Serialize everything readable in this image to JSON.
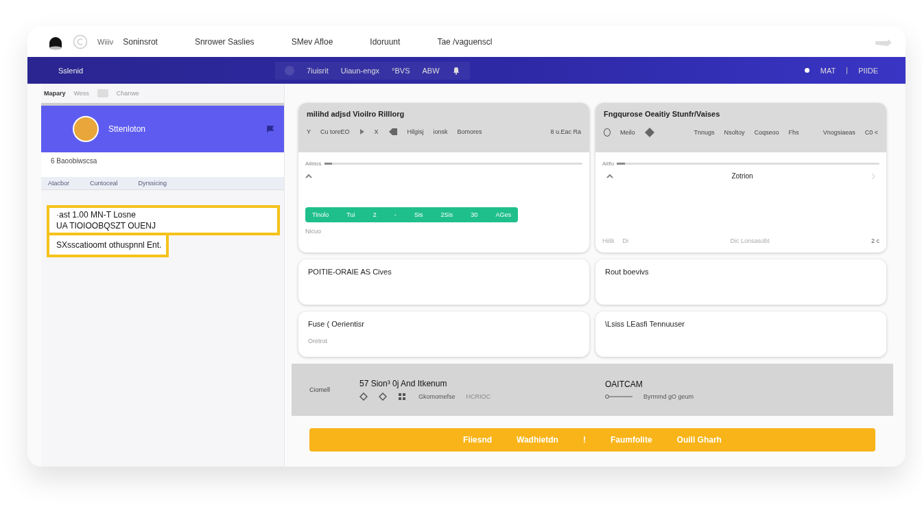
{
  "top_nav": {
    "items": [
      "Wiiiv",
      "Soninsrot",
      "Snrower Saslies",
      "SMev Afloe",
      "Idoruunt",
      "Tae /vaguenscl"
    ]
  },
  "header": {
    "title": "Sslenid",
    "center": [
      "7iuisrit",
      "Uiaun-engx",
      "°BVS",
      "ABW"
    ],
    "right": [
      "MAT",
      "PIIDE"
    ]
  },
  "sidebar": {
    "toolbar": [
      "Mapary",
      "Wess",
      "Chanwe"
    ],
    "profile_name": "Sttenloton",
    "subtitle": "6 Baoobiwscsa",
    "tabs": [
      {
        "label": "Atacbor",
        "selected": false
      },
      {
        "label": "Cuntoceal",
        "selected": false
      },
      {
        "label": "Dyrssicing",
        "selected": false
      }
    ],
    "notes": [
      {
        "lines": [
          "·ast 1.00 MN-T Losne",
          "UA TIOIOOBQSZT OUENJ"
        ]
      },
      {
        "lines": [
          "SXsscatioomt othuspnnl Ent."
        ]
      }
    ]
  },
  "panels": [
    {
      "title": "milihd adjsd Vioilro Rilllorg",
      "toolbar": [
        "Y",
        "Cu toreEO",
        "X",
        "Hilgisj",
        "ionsk",
        "Bomores",
        "8 u.Eac Ra"
      ],
      "slider": {
        "label": "Aiiblos",
        "level": 0.03
      },
      "pill": [
        "Tinolo",
        "Tui",
        "2",
        "-",
        "Sis",
        "2Sis",
        "30",
        "AGes"
      ],
      "caption": "Nicuo"
    },
    {
      "title": "Fngqurose Oeaitiy Stunfr/Vaises",
      "toolbar": [
        "Meilo",
        "Tnnugs",
        "Nsoltoy",
        "Coqseoo",
        "Fhs",
        "Vnogsiaeas",
        "C0 <"
      ],
      "slider": {
        "label": "Aiiflo",
        "level": 0.03
      },
      "center": "Zotrion",
      "footer": [
        "Hiitk",
        "Di",
        "Dic Lonsasobt",
        "2 c"
      ]
    }
  ],
  "cards": [
    {
      "title": "POITIE-ORAIE AS Cives"
    },
    {
      "title": "Rout boevivs"
    },
    {
      "title": "Fuse ( Oerientisr",
      "subtitle": "Oretrot"
    },
    {
      "title": "\\Lsiss LEasfi Tennuuser"
    }
  ],
  "summary": {
    "label": "Ciomell",
    "title": "57 Sion³ 0j And Itkenum",
    "caption": "Gkomomefse",
    "code": "HCRIOC",
    "right_title": "OAITCAM",
    "right_caption": "Byrmmd gO geum"
  },
  "action_bar": [
    "Fiiesnd",
    "Wadhietdn",
    "!",
    "Faumfolite",
    "Ouill Gharh"
  ]
}
